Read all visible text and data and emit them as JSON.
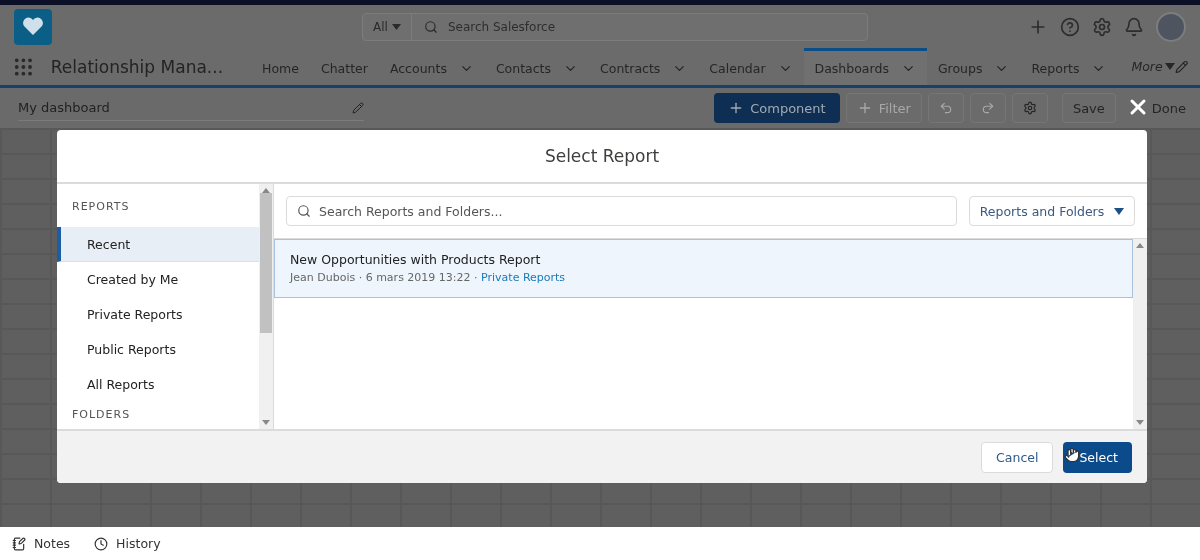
{
  "header": {
    "search_scope": "All",
    "search_placeholder": "Search Salesforce"
  },
  "nav": {
    "app_name": "Relationship Mana...",
    "items": [
      {
        "label": "Home",
        "menu": false,
        "selected": false
      },
      {
        "label": "Chatter",
        "menu": false,
        "selected": false
      },
      {
        "label": "Accounts",
        "menu": true,
        "selected": false
      },
      {
        "label": "Contacts",
        "menu": true,
        "selected": false
      },
      {
        "label": "Contracts",
        "menu": true,
        "selected": false
      },
      {
        "label": "Calendar",
        "menu": true,
        "selected": false
      },
      {
        "label": "Dashboards",
        "menu": true,
        "selected": true
      },
      {
        "label": "Groups",
        "menu": true,
        "selected": false
      },
      {
        "label": "Reports",
        "menu": true,
        "selected": false
      }
    ],
    "more": "More"
  },
  "toolbar": {
    "title": "My dashboard",
    "component": "Component",
    "filter": "Filter",
    "filter_disabled": true,
    "save": "Save",
    "done": "Done"
  },
  "modal": {
    "title": "Select Report",
    "sidebar": {
      "heading": "REPORTS",
      "items": [
        {
          "label": "Recent",
          "selected": true
        },
        {
          "label": "Created by Me",
          "selected": false
        },
        {
          "label": "Private Reports",
          "selected": false
        },
        {
          "label": "Public Reports",
          "selected": false
        },
        {
          "label": "All Reports",
          "selected": false
        }
      ],
      "heading_2": "FOLDERS"
    },
    "search_placeholder": "Search Reports and Folders...",
    "filter_dropdown": "Reports and Folders",
    "results": [
      {
        "title": "New Opportunities with Products Report",
        "meta": "Jean Dubois · 6 mars 2019 13:22 · ",
        "folder": "Private Reports",
        "selected": true
      }
    ],
    "buttons": {
      "cancel": "Cancel",
      "select": "Select"
    }
  },
  "footer": {
    "items": [
      {
        "kind": "notes",
        "label": "Notes"
      },
      {
        "kind": "history",
        "label": "History"
      }
    ]
  }
}
